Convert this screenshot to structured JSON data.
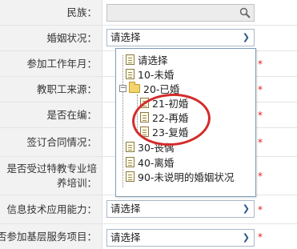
{
  "rows": [
    {
      "label": "民族：",
      "required": false
    },
    {
      "label": "婚姻状况：",
      "required": false
    },
    {
      "label": "参加工作年月：",
      "required": true
    },
    {
      "label": "教职工来源：",
      "required": true
    },
    {
      "label": "是否在编：",
      "required": true
    },
    {
      "label": "签订合同情况：",
      "required": true
    },
    {
      "label": "是否受过特教专业培养培训：",
      "required": true
    },
    {
      "label": "信息技术应用能力：",
      "required": true
    },
    {
      "label": "是否参加基层服务项目：",
      "required": true
    }
  ],
  "required_mark": "*",
  "fields": {
    "marital_status_value": "请选择",
    "it_ability_value": "请选择",
    "grassroots_value": "请选择"
  },
  "dropdown": {
    "items": [
      {
        "label": "请选择",
        "icon": "doc-icon",
        "level": 0
      },
      {
        "label": "10-未婚",
        "icon": "doc-icon",
        "level": 0
      },
      {
        "label": "20-已婚",
        "icon": "folder-icon",
        "level": 0,
        "expanded": true
      },
      {
        "label": "21-初婚",
        "icon": "doc-icon",
        "level": 1
      },
      {
        "label": "22-再婚",
        "icon": "doc-icon",
        "level": 1
      },
      {
        "label": "23-复婚",
        "icon": "doc-icon",
        "level": 1
      },
      {
        "label": "30-丧偶",
        "icon": "doc-icon",
        "level": 0
      },
      {
        "label": "40-离婚",
        "icon": "doc-icon",
        "level": 0
      },
      {
        "label": "90-未说明的婚姻状况",
        "icon": "doc-icon",
        "level": 0
      }
    ]
  },
  "colors": {
    "highlight": "#d42b2b",
    "required": "#e02020"
  }
}
